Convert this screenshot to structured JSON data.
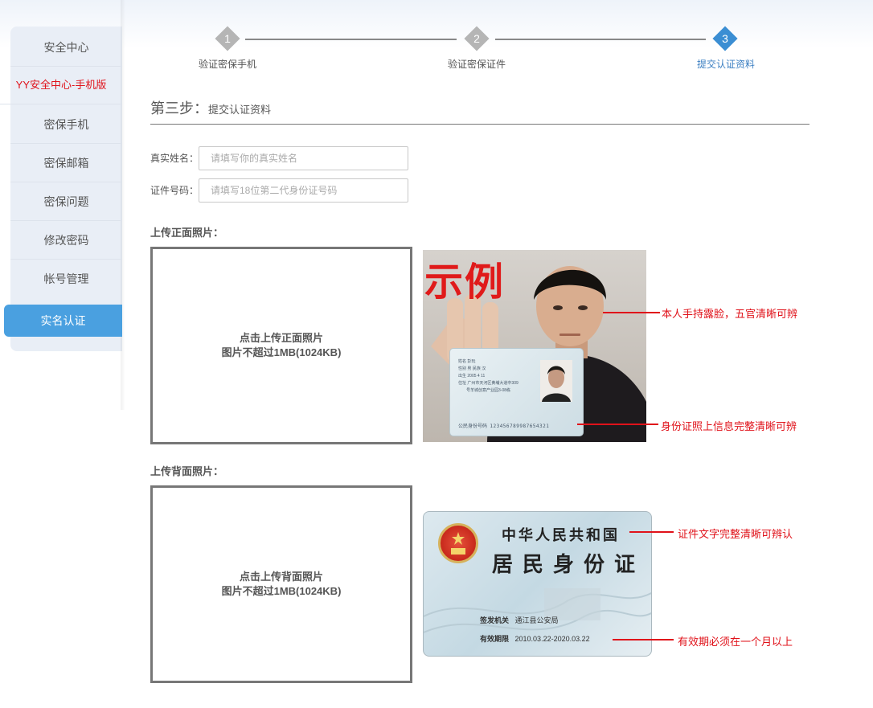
{
  "sidebar": {
    "items": [
      {
        "label": "安全中心"
      },
      {
        "label": "YY安全中心-手机版"
      },
      {
        "label": "密保手机"
      },
      {
        "label": "密保邮箱"
      },
      {
        "label": "密保问题"
      },
      {
        "label": "修改密码"
      },
      {
        "label": "帐号管理"
      },
      {
        "label": "实名认证"
      }
    ],
    "active_index": 7
  },
  "steps": [
    {
      "num": "1",
      "label": "验证密保手机"
    },
    {
      "num": "2",
      "label": "验证密保证件"
    },
    {
      "num": "3",
      "label": "提交认证资料"
    }
  ],
  "section": {
    "step_prefix": "第三步：",
    "title": "提交认证资料"
  },
  "form": {
    "name_label": "真实姓名：",
    "name_placeholder": "请填写你的真实姓名",
    "id_label": "证件号码：",
    "id_placeholder": "请填写18位第二代身份证号码"
  },
  "front": {
    "heading": "上传正面照片：",
    "upload_line1": "点击上传正面照片",
    "upload_line2": "图片不超过1MB(1024KB)",
    "sample_badge": "示例",
    "annot_face": "本人手持露脸，五官清晰可辨",
    "annot_card": "身份证照上信息完整清晰可辨",
    "card": {
      "name_key": "姓名",
      "name_val": "彭玩",
      "sex_key": "性别",
      "sex_val": "男",
      "eth_key": "民族",
      "eth_val": "汉",
      "birth_key": "出生",
      "birth_val": "2005  4  11",
      "addr_key": "住址",
      "addr_val1": "广州市天河区黄埔大道中309",
      "addr_val2": "号羊城创意产业园3-08栋",
      "idno_key": "公民身份号码",
      "idno_val": "123456789987654321"
    }
  },
  "back": {
    "heading": "上传背面照片：",
    "upload_line1": "点击上传背面照片",
    "upload_line2": "图片不超过1MB(1024KB)",
    "card_title": "中华人民共和国",
    "card_subtitle": "居民身份证",
    "issuer_key": "签发机关",
    "issuer_val": "通江县公安局",
    "valid_key": "有效期限",
    "valid_val": "2010.03.22-2020.03.22",
    "annot_text": "证件文字完整清晰可辨认",
    "annot_valid": "有效期必须在一个月以上"
  },
  "colors": {
    "accent": "#4aa0e0",
    "step_active": "#3b8ed3",
    "annotation": "#e0121a"
  }
}
